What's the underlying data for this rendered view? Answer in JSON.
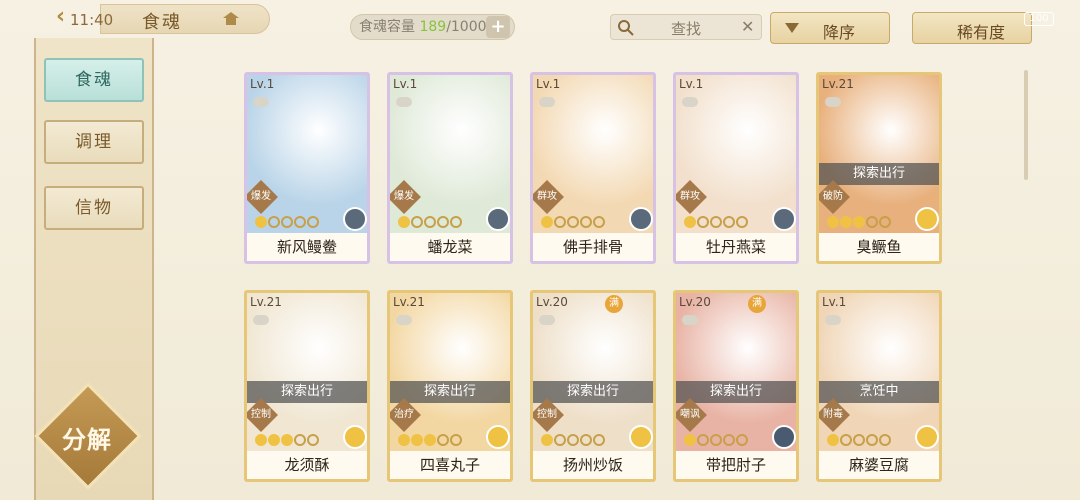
{
  "top": {
    "back_glyph": "‹",
    "time": "11:40",
    "title": "食魂",
    "capacity_label": "食魂容量 ",
    "capacity_now": "189",
    "capacity_max": "/1000",
    "plus_label": "+",
    "search_placeholder": "查找",
    "search_clear": "✕",
    "sort_label": "降序",
    "rarity_label": "稀有度",
    "battery": "100"
  },
  "sidebar": {
    "items": [
      {
        "label": "食魂",
        "active": true
      },
      {
        "label": "调理",
        "active": false
      },
      {
        "label": "信物",
        "active": false
      }
    ],
    "decompose_label": "分解"
  },
  "cards": [
    {
      "level": "Lv.1",
      "name": "新风鳗鲞",
      "type": "爆发",
      "status": "",
      "full": "",
      "stars_on": 1,
      "frame": "rainbow",
      "art": "#b9d4e8",
      "elem": "#5a6a7a"
    },
    {
      "level": "Lv.1",
      "name": "蟠龙菜",
      "type": "爆发",
      "status": "",
      "full": "",
      "stars_on": 1,
      "frame": "rainbow",
      "art": "#dfe9d8",
      "elem": "#5a6a7a"
    },
    {
      "level": "Lv.1",
      "name": "佛手排骨",
      "type": "群攻",
      "status": "",
      "full": "",
      "stars_on": 1,
      "frame": "rainbow",
      "art": "#f3d9b3",
      "elem": "#5a6a7a"
    },
    {
      "level": "Lv.1",
      "name": "牡丹燕菜",
      "type": "群攻",
      "status": "",
      "full": "",
      "stars_on": 1,
      "frame": "rainbow",
      "art": "#f2e0cc",
      "elem": "#5a6a7a"
    },
    {
      "level": "Lv.21",
      "name": "臭鳜鱼",
      "type": "破防",
      "status": "探索出行",
      "full": "",
      "stars_on": 3,
      "frame": "gold",
      "art": "#e8b07c",
      "elem": "#f0c244"
    },
    {
      "level": "Lv.21",
      "name": "龙须酥",
      "type": "控制",
      "status": "探索出行",
      "full": "",
      "stars_on": 3,
      "frame": "gold",
      "art": "#f0e6d2",
      "elem": "#f0c244"
    },
    {
      "level": "Lv.21",
      "name": "四喜丸子",
      "type": "治疗",
      "status": "探索出行",
      "full": "",
      "stars_on": 3,
      "frame": "gold",
      "art": "#f3d7a2",
      "elem": "#f0c244"
    },
    {
      "level": "Lv.20",
      "name": "扬州炒饭",
      "type": "控制",
      "status": "探索出行",
      "full": "满",
      "stars_on": 1,
      "frame": "gold",
      "art": "#eedfc8",
      "elem": "#f0c244"
    },
    {
      "level": "Lv.20",
      "name": "带把肘子",
      "type": "嘲讽",
      "status": "探索出行",
      "full": "满",
      "stars_on": 1,
      "frame": "gold",
      "art": "#e8b3a4",
      "elem": "#4a5a70"
    },
    {
      "level": "Lv.1",
      "name": "麻婆豆腐",
      "type": "附毒",
      "status": "烹饪中",
      "full": "",
      "stars_on": 1,
      "frame": "gold",
      "art": "#f0d5b6",
      "elem": "#f0c244"
    }
  ]
}
